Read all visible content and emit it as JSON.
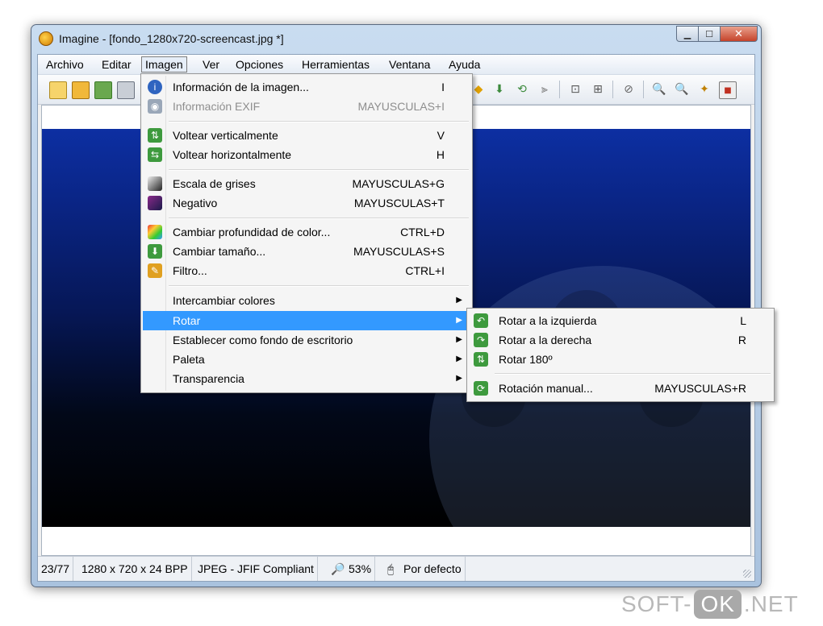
{
  "window": {
    "title": "Imagine - [fondo_1280x720-screencast.jpg *]"
  },
  "menubar": [
    "Archivo",
    "Editar",
    "Imagen",
    "Ver",
    "Opciones",
    "Herramientas",
    "Ventana",
    "Ayuda"
  ],
  "image_menu": {
    "items": [
      {
        "label": "Información de la imagen...",
        "shortcut": "I",
        "icon": "info-icon",
        "disabled": false
      },
      {
        "label": "Información EXIF",
        "shortcut": "MAYUSCULAS+I",
        "icon": "camera-icon",
        "disabled": true
      },
      {
        "label": "Voltear verticalmente",
        "shortcut": "V",
        "icon": "flip-vertical-icon"
      },
      {
        "label": "Voltear horizontalmente",
        "shortcut": "H",
        "icon": "flip-horizontal-icon"
      },
      {
        "label": "Escala de grises",
        "shortcut": "MAYUSCULAS+G",
        "icon": "grayscale-icon"
      },
      {
        "label": "Negativo",
        "shortcut": "MAYUSCULAS+T",
        "icon": "negative-icon"
      },
      {
        "label": "Cambiar profundidad de color...",
        "shortcut": "CTRL+D",
        "icon": "color-depth-icon"
      },
      {
        "label": "Cambiar tamaño...",
        "shortcut": "MAYUSCULAS+S",
        "icon": "resize-icon"
      },
      {
        "label": "Filtro...",
        "shortcut": "CTRL+I",
        "icon": "filter-icon"
      },
      {
        "label": "Intercambiar colores"
      },
      {
        "label": "Rotar"
      },
      {
        "label": "Establecer como fondo de escritorio"
      },
      {
        "label": "Paleta"
      },
      {
        "label": "Transparencia"
      }
    ]
  },
  "rotate_submenu": {
    "items": [
      {
        "label": "Rotar a la izquierda",
        "shortcut": "L",
        "icon": "rotate-left-icon"
      },
      {
        "label": "Rotar a la derecha",
        "shortcut": "R",
        "icon": "rotate-right-icon"
      },
      {
        "label": "Rotar 180º",
        "shortcut": "",
        "icon": "rotate-180-icon"
      },
      {
        "label": "Rotación manual...",
        "shortcut": "MAYUSCULAS+R",
        "icon": "rotate-manual-icon"
      }
    ]
  },
  "statusbar": {
    "position": "23/77",
    "dimensions": "1280 x 720 x 24 BPP",
    "format": "JPEG - JFIF Compliant",
    "zoom": "53%",
    "mode": "Por defecto"
  },
  "watermark": {
    "left": "SOFT-",
    "ok": "OK",
    "right": ".NET"
  },
  "colors": {
    "highlight": "#3399ff",
    "image_top": "#0d2fa2",
    "image_bottom": "#000000"
  }
}
